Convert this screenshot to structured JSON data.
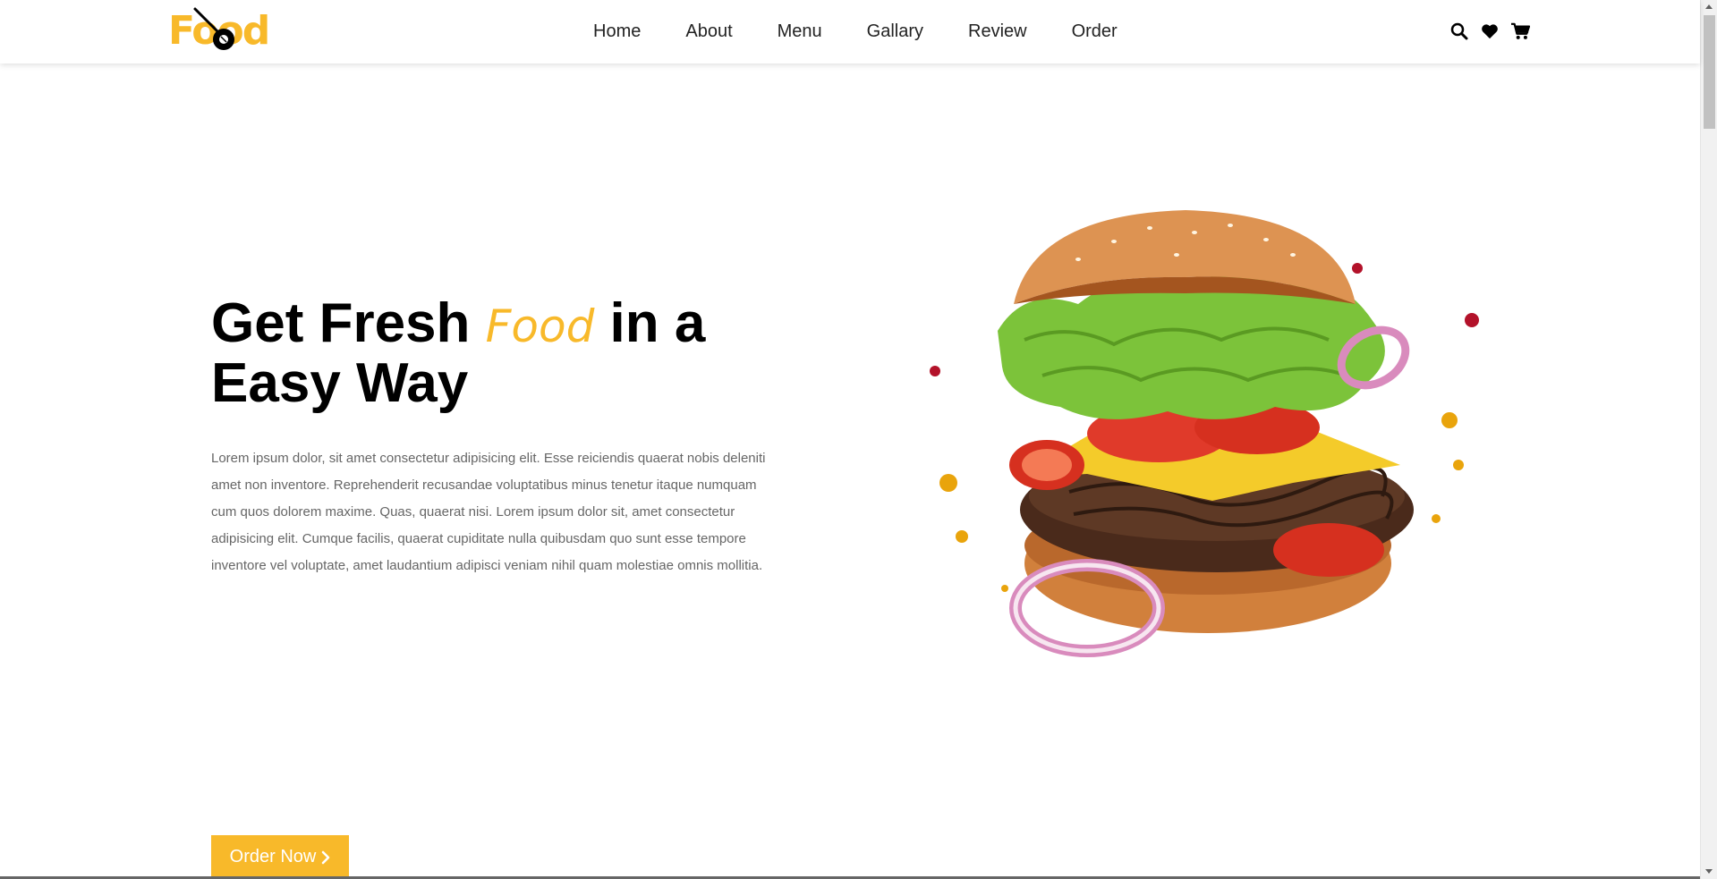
{
  "header": {
    "logo_text": "Food",
    "nav": [
      "Home",
      "About",
      "Menu",
      "Gallary",
      "Review",
      "Order"
    ],
    "icons": [
      "search-icon",
      "heart-icon",
      "cart-icon"
    ]
  },
  "hero": {
    "title_part1": "Get Fresh ",
    "title_accent": "Food",
    "title_part2": " in a",
    "title_line2": "Easy Way",
    "text": "Lorem ipsum dolor, sit amet consectetur adipisicing elit. Esse reiciendis quaerat nobis deleniti amet non inventore. Reprehenderit recusandae voluptatibus minus tenetur itaque numquam cum quos dolorem maxime. Quas, quaerat nisi. Lorem ipsum dolor sit, amet consectetur adipisicing elit. Cumque facilis, quaerat cupiditate nulla quibusdam quo sunt esse tempore inventore vel voluptate, amet laudantium adipisci veniam nihil quam molestiae omnis mollitia.",
    "button_label": "Order Now"
  },
  "colors": {
    "accent": "#f8b92a",
    "text": "#000000",
    "muted": "#666666"
  }
}
